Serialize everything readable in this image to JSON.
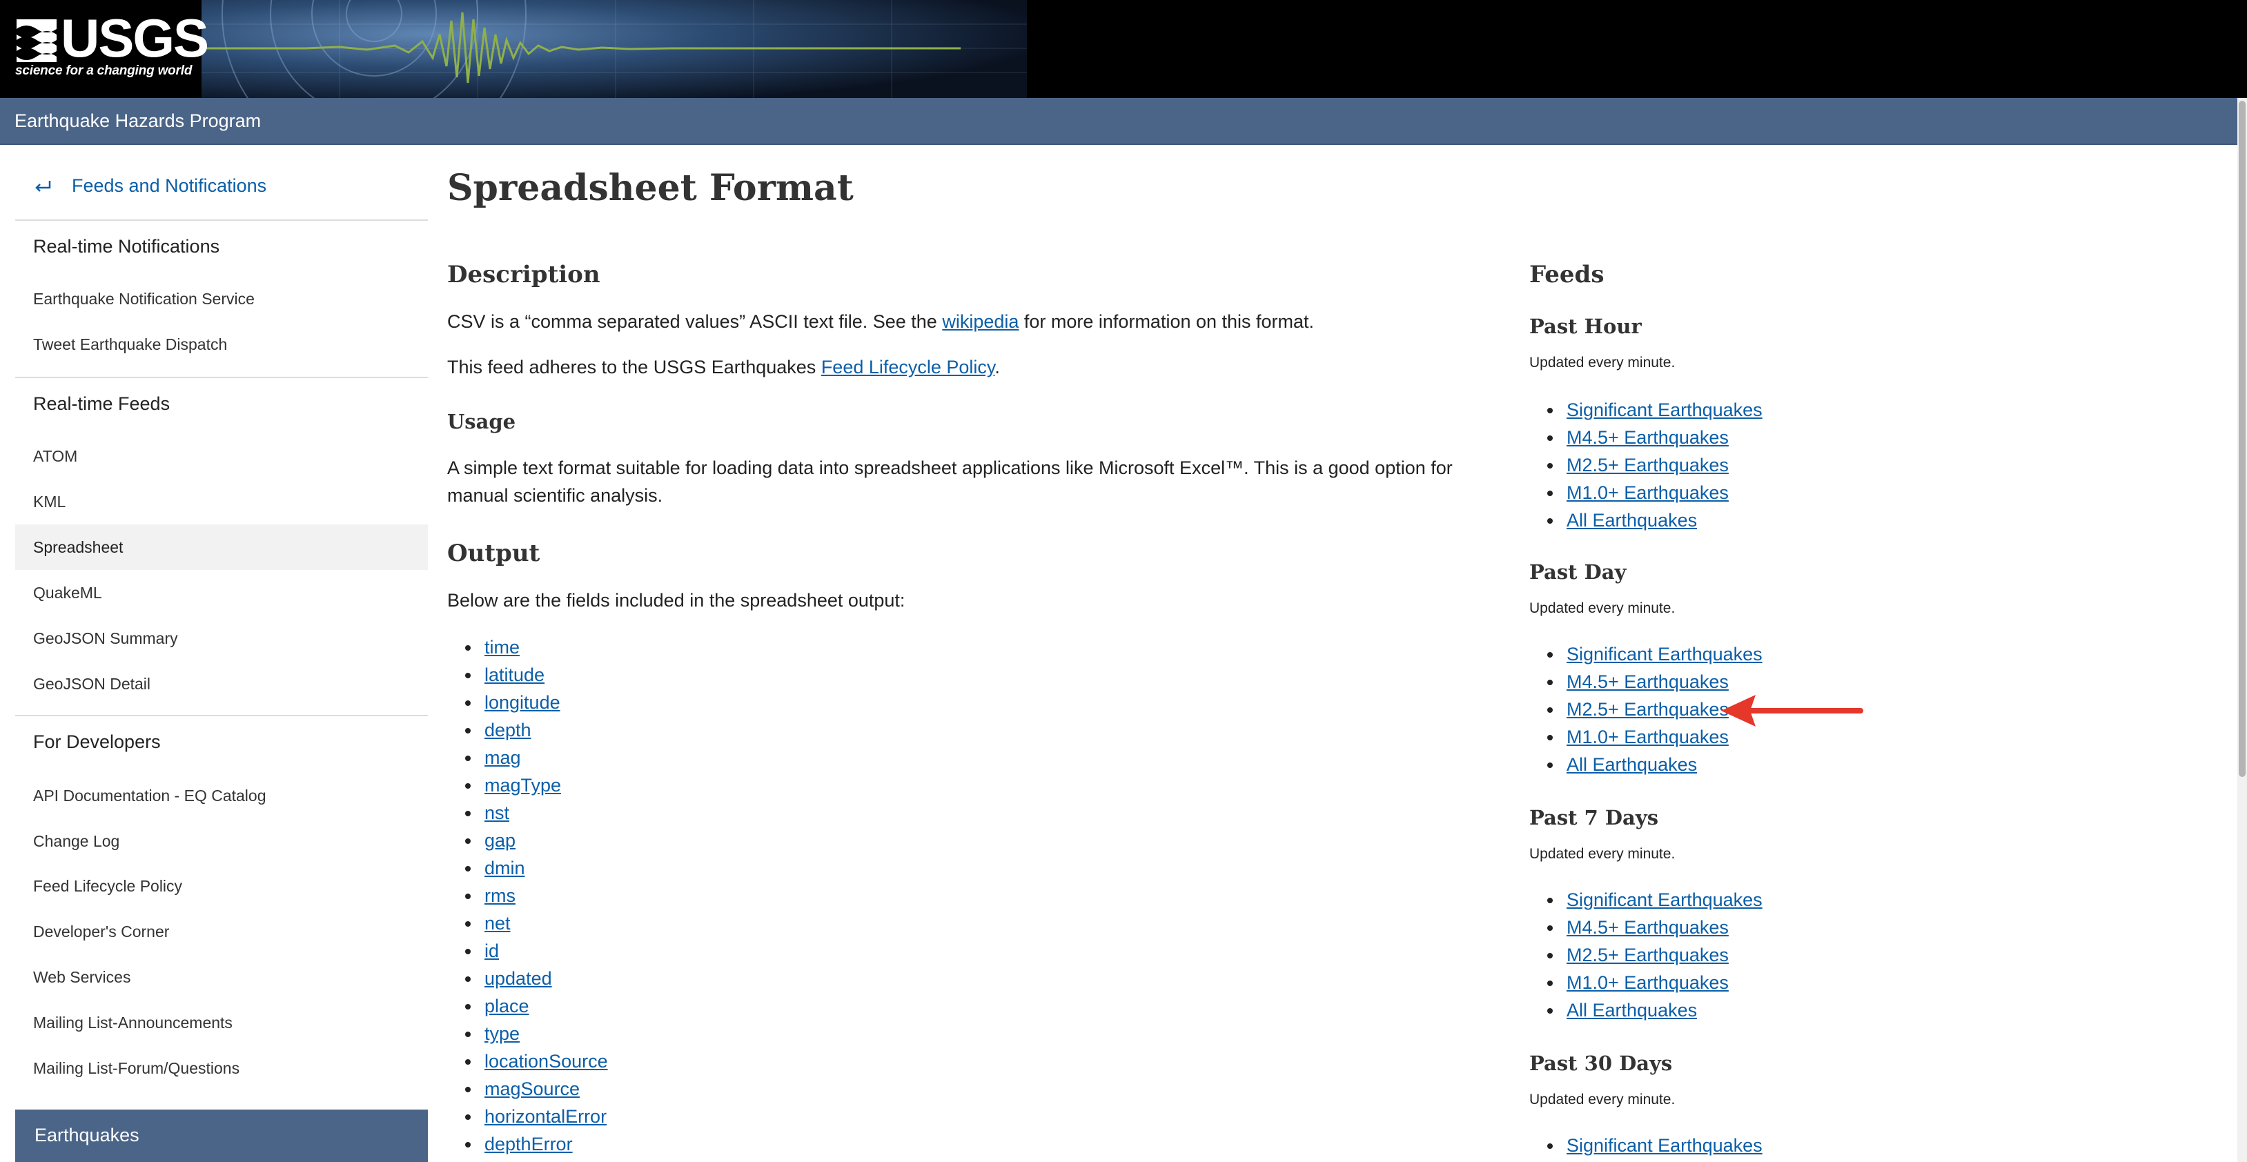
{
  "header": {
    "logo_text": "USGS",
    "logo_tagline": "science for a changing world",
    "program_name": "Earthquake Hazards Program"
  },
  "sidebar": {
    "back_link": "Feeds and Notifications",
    "sections": [
      {
        "heading": "Real-time Notifications",
        "items": [
          "Earthquake Notification Service",
          "Tweet Earthquake Dispatch"
        ]
      },
      {
        "heading": "Real-time Feeds",
        "items": [
          "ATOM",
          "KML",
          "Spreadsheet",
          "QuakeML",
          "GeoJSON Summary",
          "GeoJSON Detail"
        ]
      },
      {
        "heading": "For Developers",
        "items": [
          "API Documentation - EQ Catalog",
          "Change Log",
          "Feed Lifecycle Policy",
          "Developer's Corner",
          "Web Services",
          "Mailing List-Announcements",
          "Mailing List-Forum/Questions"
        ]
      }
    ],
    "active_item": "Spreadsheet",
    "footer": "Earthquakes"
  },
  "main": {
    "title": "Spreadsheet Format",
    "description_heading": "Description",
    "desc_p1_before": "CSV is a “comma separated values” ASCII text file. See the ",
    "desc_p1_link": "wikipedia",
    "desc_p1_after": " for more information on this format.",
    "desc_p2_before": "This feed adheres to the USGS Earthquakes ",
    "desc_p2_link": "Feed Lifecycle Policy",
    "desc_p2_after": ".",
    "usage_heading": "Usage",
    "usage_text": "A simple text format suitable for loading data into spreadsheet applications like Microsoft Excel™. This is a good option for manual scientific analysis.",
    "output_heading": "Output",
    "output_text": "Below are the fields included in the spreadsheet output:",
    "fields": [
      "time",
      "latitude",
      "longitude",
      "depth",
      "mag",
      "magType",
      "nst",
      "gap",
      "dmin",
      "rms",
      "net",
      "id",
      "updated",
      "place",
      "type",
      "locationSource",
      "magSource",
      "horizontalError",
      "depthError"
    ]
  },
  "feeds": {
    "heading": "Feeds",
    "groups": [
      {
        "title": "Past Hour",
        "updated": "Updated every minute.",
        "links": [
          "Significant Earthquakes",
          "M4.5+ Earthquakes",
          "M2.5+ Earthquakes",
          "M1.0+ Earthquakes",
          "All Earthquakes"
        ]
      },
      {
        "title": "Past Day",
        "updated": "Updated every minute.",
        "links": [
          "Significant Earthquakes",
          "M4.5+ Earthquakes",
          "M2.5+ Earthquakes",
          "M1.0+ Earthquakes",
          "All Earthquakes"
        ]
      },
      {
        "title": "Past 7 Days",
        "updated": "Updated every minute.",
        "links": [
          "Significant Earthquakes",
          "M4.5+ Earthquakes",
          "M2.5+ Earthquakes",
          "M1.0+ Earthquakes",
          "All Earthquakes"
        ]
      },
      {
        "title": "Past 30 Days",
        "updated": "Updated every minute.",
        "links": [
          "Significant Earthquakes"
        ]
      }
    ]
  },
  "annotation": {
    "arrow_color": "#e5372a",
    "arrow_icon": "red-arrow-icon"
  },
  "colors": {
    "link": "#0b5ea8",
    "program_bar": "#4b6588",
    "seismogram": "#8fb04a"
  }
}
